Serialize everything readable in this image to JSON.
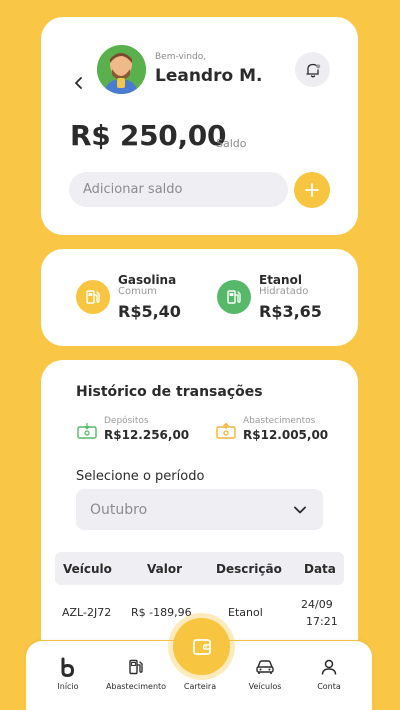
{
  "profile": {
    "welcome": "Bem-vindo,",
    "name": "Leandro M."
  },
  "balance": {
    "amount": "R$ 250,00",
    "label": "Saldo",
    "add_placeholder": "Adicionar saldo"
  },
  "fuels": [
    {
      "name": "Gasolina",
      "type": "Comum",
      "price": "R$5,40",
      "icon": "fuel-pump-icon",
      "color": "#F7C53F"
    },
    {
      "name": "Etanol",
      "type": "Hidratado",
      "price": "R$3,65",
      "icon": "fuel-pump-icon",
      "color": "#57B86A"
    }
  ],
  "history": {
    "title": "Histórico de transações",
    "deposits": {
      "label": "Depósitos",
      "value": "R$12.256,00",
      "icon": "deposit-icon",
      "color": "#57B86A"
    },
    "refuels": {
      "label": "Abastecimentos",
      "value": "R$12.005,00",
      "icon": "withdraw-icon",
      "color": "#F2B33D"
    },
    "period_label": "Selecione o período",
    "period_value": "Outubro",
    "columns": [
      "Veículo",
      "Valor",
      "Descrição",
      "Data"
    ],
    "rows": [
      {
        "vehicle": "AZL-2J72",
        "value": "R$ -189,96",
        "description": "Etanol",
        "date": "24/09",
        "time": "17:21"
      }
    ]
  },
  "nav": {
    "items": [
      {
        "label": "Início",
        "icon": "home-logo-icon"
      },
      {
        "label": "Abastecimento",
        "icon": "fuel-pump-icon"
      },
      {
        "label": "Carteira",
        "icon": "wallet-icon"
      },
      {
        "label": "Veículos",
        "icon": "car-icon"
      },
      {
        "label": "Conta",
        "icon": "user-icon"
      }
    ]
  },
  "colors": {
    "background": "#F9C646",
    "accent": "#F7C53F",
    "green": "#57B86A",
    "field": "#EEEEF3"
  }
}
